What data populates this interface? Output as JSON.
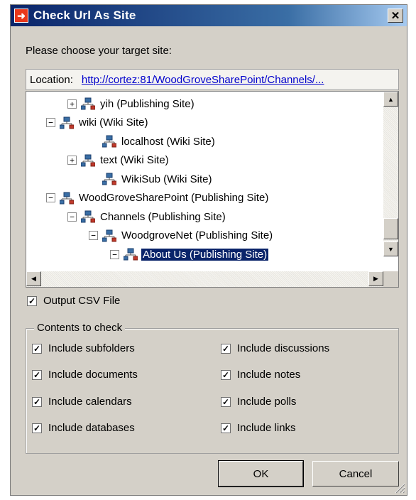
{
  "window": {
    "title": "Check Url As Site",
    "close_symbol": "✕"
  },
  "prompt": "Please choose your target site:",
  "location": {
    "label": "Location:",
    "url": "http://cortez:81/WoodGroveSharePoint/Channels/..."
  },
  "tree": {
    "nodes": [
      {
        "label": "yih (Publishing Site)",
        "expander": "+"
      },
      {
        "label": "wiki (Wiki Site)",
        "expander": "−"
      },
      {
        "label": "localhost (Wiki Site)",
        "expander": ""
      },
      {
        "label": "text (Wiki Site)",
        "expander": "+"
      },
      {
        "label": "WikiSub (Wiki Site)",
        "expander": ""
      },
      {
        "label": "WoodGroveSharePoint (Publishing Site)",
        "expander": "−"
      },
      {
        "label": "Channels (Publishing Site)",
        "expander": "−"
      },
      {
        "label": "WoodgroveNet (Publishing Site)",
        "expander": "−"
      },
      {
        "label": "About Us (Publishing Site)",
        "expander": "−",
        "selected": true
      }
    ]
  },
  "output_csv": {
    "label": "Output CSV File",
    "checked": true
  },
  "contents": {
    "legend": "Contents to check",
    "left": [
      {
        "label": "Include subfolders",
        "checked": true
      },
      {
        "label": "Include documents",
        "checked": true
      },
      {
        "label": "Include calendars",
        "checked": true
      },
      {
        "label": "Include databases",
        "checked": true
      }
    ],
    "right": [
      {
        "label": "Include discussions",
        "checked": true
      },
      {
        "label": "Include notes",
        "checked": true
      },
      {
        "label": "Include polls",
        "checked": true
      },
      {
        "label": "Include links",
        "checked": true
      }
    ]
  },
  "buttons": {
    "ok": "OK",
    "cancel": "Cancel"
  },
  "check_mark": "✓",
  "icons": {
    "title": "arrow-right-icon",
    "site": "network-site-icon",
    "close": "close-icon"
  },
  "colors": {
    "title_bar": "#0a246a",
    "title_icon": "#e8381c",
    "link": "#0000cc",
    "selection": "#0a246a",
    "dialog_bg": "#d4d0c8"
  }
}
